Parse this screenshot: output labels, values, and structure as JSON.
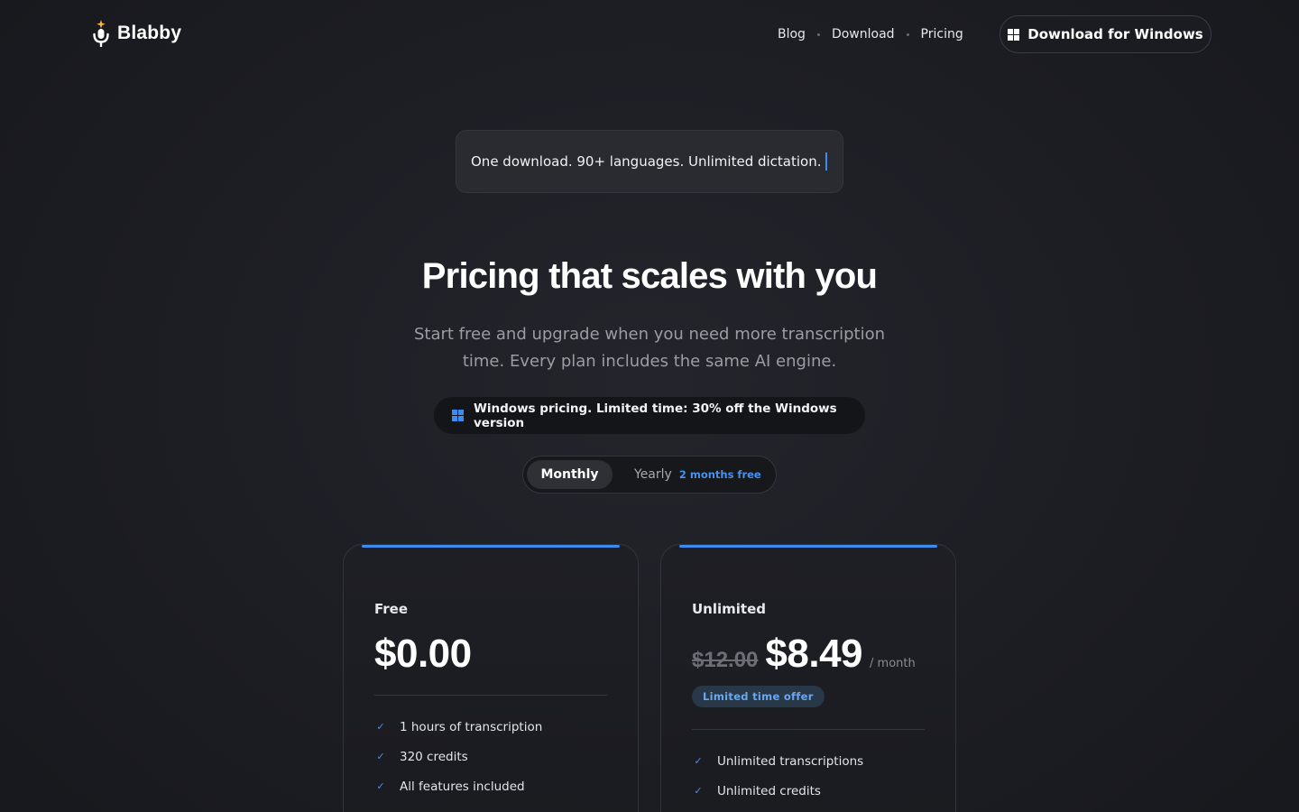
{
  "brand": {
    "name": "Blabby",
    "logo_icon": "microphone-sparkle-icon"
  },
  "nav": {
    "links": [
      "Blog",
      "Download",
      "Pricing"
    ],
    "cta_label": "Download for Windows",
    "cta_icon": "windows-icon"
  },
  "hero": {
    "typewriter_text": "One download. 90+ languages. Unlimited dictation.",
    "title": "Pricing that scales with you",
    "subtitle": "Start free and upgrade when you need more transcription time. Every plan includes the same AI engine."
  },
  "promo": {
    "text": "Windows pricing. Limited time: 30% off the Windows version",
    "icon": "windows-icon"
  },
  "billing_toggle": {
    "monthly": "Monthly",
    "yearly": "Yearly",
    "yearly_note": "2 months free",
    "selected": "Monthly"
  },
  "plans": [
    {
      "name": "Free",
      "price": "$0.00",
      "features": [
        "1 hours of transcription",
        "320 credits",
        "All features included"
      ]
    },
    {
      "name": "Unlimited",
      "old_price": "$12.00",
      "price": "$8.49",
      "period": "/ month",
      "badge": "Limited time offer",
      "features": [
        "Unlimited transcriptions",
        "Unlimited credits"
      ]
    }
  ],
  "colors": {
    "accent": "#3d8bf0",
    "background": "#1d1e24",
    "text": "#ffffff",
    "muted": "#9b9ca4"
  }
}
